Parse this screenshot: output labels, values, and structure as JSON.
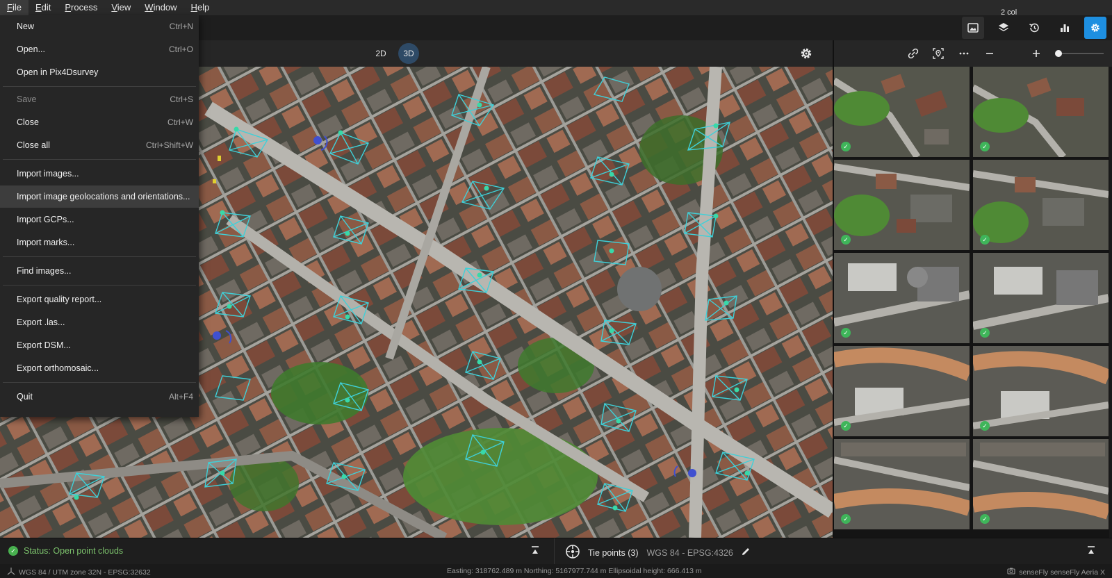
{
  "menubar": {
    "items": [
      {
        "label": "File",
        "mnemonic": "F",
        "rest": "ile",
        "active": true
      },
      {
        "label": "Edit",
        "mnemonic": "E",
        "rest": "dit"
      },
      {
        "label": "Process",
        "mnemonic": "P",
        "rest": "rocess"
      },
      {
        "label": "View",
        "mnemonic": "V",
        "rest": "iew"
      },
      {
        "label": "Window",
        "mnemonic": "W",
        "rest": "indow"
      },
      {
        "label": "Help",
        "mnemonic": "H",
        "rest": "elp"
      }
    ]
  },
  "file_menu": {
    "items": [
      {
        "label": "New",
        "shortcut": "Ctrl+N"
      },
      {
        "label": "Open...",
        "shortcut": "Ctrl+O"
      },
      {
        "label": "Open in Pix4Dsurvey",
        "shortcut": ""
      },
      {
        "label": "Save",
        "shortcut": "Ctrl+S",
        "disabled": true
      },
      {
        "label": "Close",
        "shortcut": "Ctrl+W"
      },
      {
        "label": "Close all",
        "shortcut": "Ctrl+Shift+W"
      },
      {
        "label": "Import images...",
        "shortcut": ""
      },
      {
        "label": "Import image geolocations and orientations...",
        "shortcut": "",
        "hover": true
      },
      {
        "label": "Import GCPs...",
        "shortcut": ""
      },
      {
        "label": "Import marks...",
        "shortcut": ""
      },
      {
        "label": "Find images...",
        "shortcut": ""
      },
      {
        "label": "Export quality report...",
        "shortcut": ""
      },
      {
        "label": "Export .las...",
        "shortcut": ""
      },
      {
        "label": "Export DSM...",
        "shortcut": ""
      },
      {
        "label": "Export orthomosaic...",
        "shortcut": ""
      },
      {
        "label": "Quit",
        "shortcut": "Alt+F4"
      }
    ]
  },
  "top_toolbar": {
    "icons": [
      "images-icon",
      "layers-icon",
      "history-icon",
      "bar-chart-icon",
      "settings-icon"
    ],
    "accent_color": "#1e8fe0"
  },
  "view_toolbar": {
    "mode_2d": "2D",
    "mode_3d": "3D",
    "active_mode": "3D"
  },
  "gallery_toolbar": {
    "columns_label": "2 col",
    "zoom_value": 0.05
  },
  "status": {
    "text": "Status: Open point clouds",
    "color": "#7cc26c"
  },
  "tie_points": {
    "label": "Tie points (3)",
    "crs": "WGS 84 - EPSG:4326"
  },
  "info": {
    "crs": "WGS 84 / UTM zone 32N - EPSG:32632",
    "coords": "Easting: 318762.489 m   Northing: 5167977.744 m   Ellipsoidal height: 666.413 m",
    "camera": "senseFly senseFly Aeria X"
  }
}
